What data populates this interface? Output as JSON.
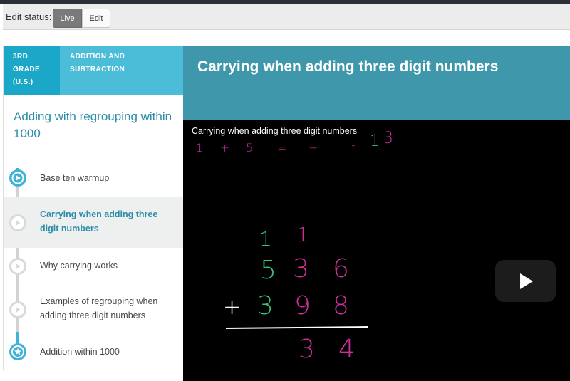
{
  "edit_bar": {
    "label": "Edit status:",
    "live_label": "Live",
    "edit_label": "Edit"
  },
  "breadcrumbs": [
    {
      "label": "3RD GRADE (U.S.)"
    },
    {
      "label": "ADDITION AND SUBTRACTION"
    }
  ],
  "topic": {
    "title": "Adding with regrouping within 1000"
  },
  "items": [
    {
      "label": "Base ten warmup",
      "state": "done",
      "icon": "play-icon"
    },
    {
      "label": "Carrying when adding three digit numbers",
      "state": "current",
      "icon": "play-icon"
    },
    {
      "label": "Why carrying works",
      "state": "todo",
      "icon": "play-icon"
    },
    {
      "label": "Examples of regrouping when adding three digit numbers",
      "state": "todo",
      "icon": "play-icon"
    },
    {
      "label": "Addition within 1000",
      "state": "mastery",
      "icon": "star-icon"
    }
  ],
  "content": {
    "title": "Carrying when adding three digit numbers"
  },
  "video": {
    "title": "Carrying when adding three digit numbers",
    "board": {
      "top_scribble": [
        "1",
        "+",
        "5",
        "=",
        "+",
        "-",
        "1",
        "3"
      ],
      "carry_row": [
        "1",
        "1"
      ],
      "row1": [
        "5",
        "3",
        "6"
      ],
      "operator": "+",
      "row2": [
        "3",
        "9",
        "8"
      ],
      "result": [
        "3",
        "4"
      ]
    }
  },
  "colors": {
    "breadcrumb_dark": "#1ba7c8",
    "breadcrumb_light": "#4cbdd9",
    "header": "#3e97aa",
    "accent": "#3fb3d5",
    "link": "#2b8da8",
    "board_green": "#3fbf7a",
    "board_magenta": "#cc2f9a"
  }
}
